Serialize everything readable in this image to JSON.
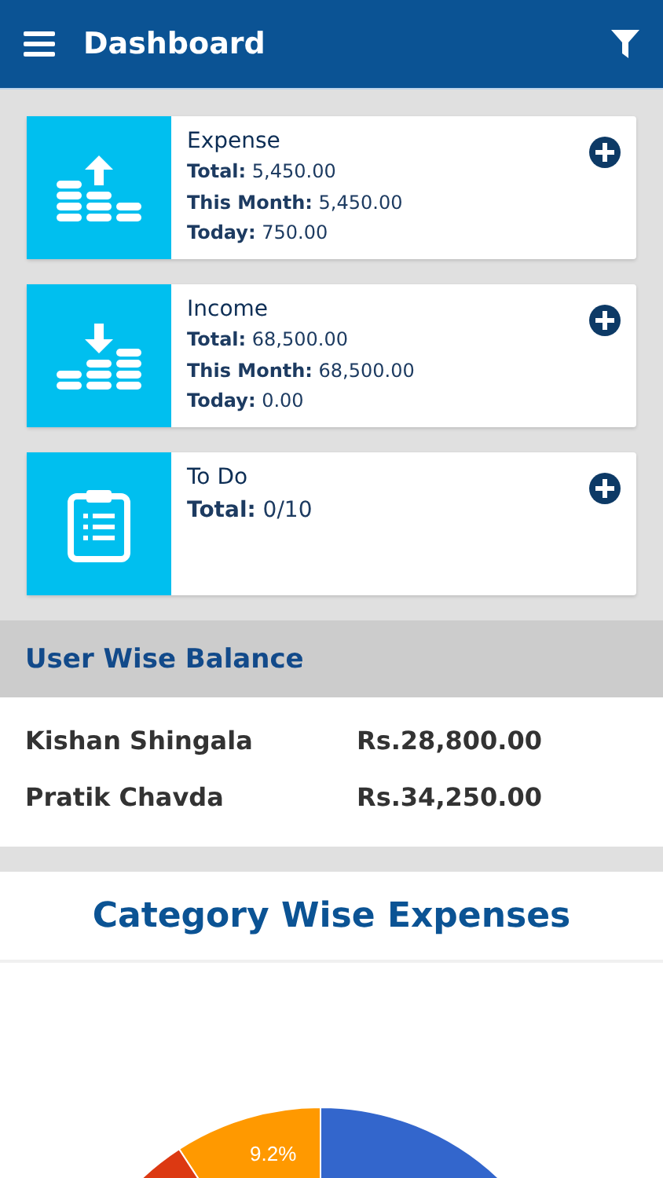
{
  "header": {
    "title": "Dashboard"
  },
  "cards": [
    {
      "kind": "expense",
      "title": "Expense",
      "lines": [
        {
          "label": "Total:",
          "value": "5,450.00"
        },
        {
          "label": "This Month:",
          "value": "5,450.00"
        },
        {
          "label": "Today:",
          "value": "750.00"
        }
      ]
    },
    {
      "kind": "income",
      "title": "Income",
      "lines": [
        {
          "label": "Total:",
          "value": "68,500.00"
        },
        {
          "label": "This Month:",
          "value": "68,500.00"
        },
        {
          "label": "Today:",
          "value": "0.00"
        }
      ]
    },
    {
      "kind": "todo",
      "title": "To Do",
      "lines": [
        {
          "label": "Total:",
          "value": "0/10"
        }
      ]
    }
  ],
  "balance": {
    "title": "User Wise Balance",
    "rows": [
      {
        "name": "Kishan Shingala",
        "amount": "Rs.28,800.00"
      },
      {
        "name": "Pratik Chavda",
        "amount": "Rs.34,250.00"
      }
    ]
  },
  "category": {
    "title": "Category Wise Expenses",
    "slice_label": "9.2%"
  }
}
